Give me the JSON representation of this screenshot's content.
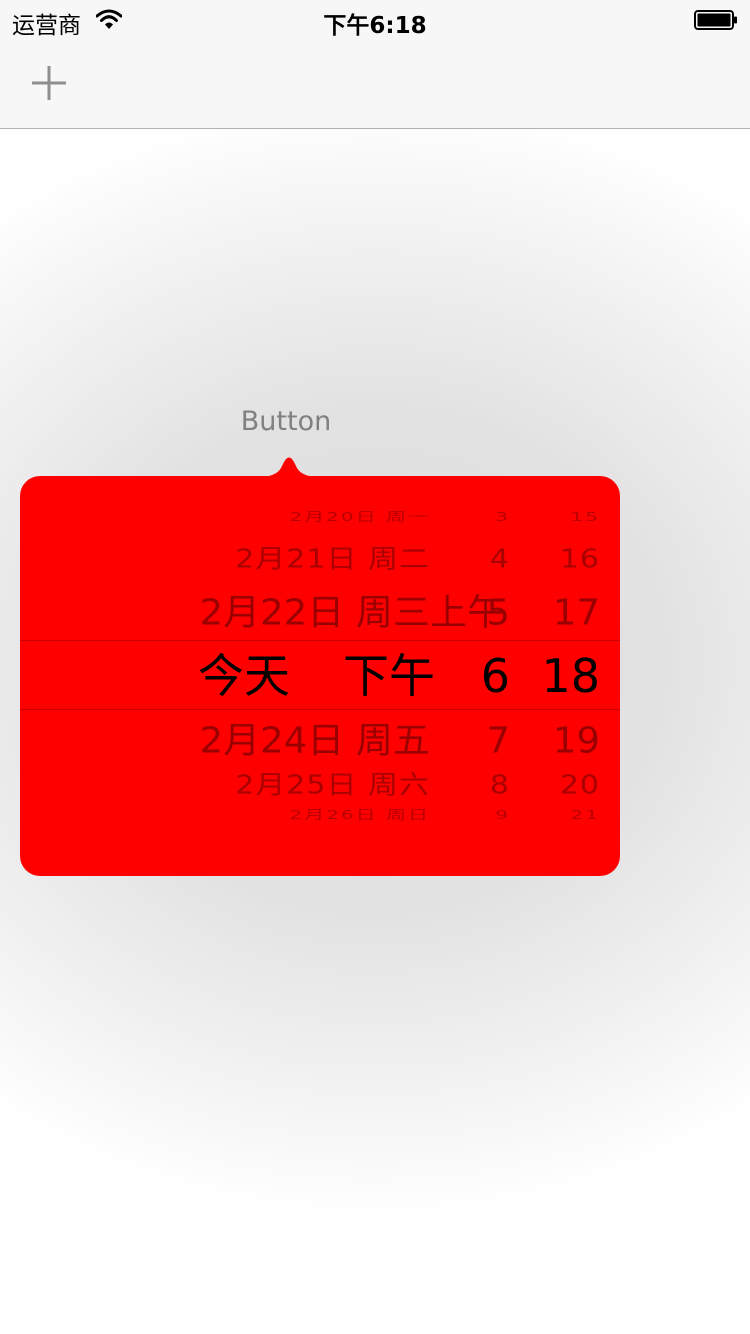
{
  "status_bar": {
    "carrier": "运营商",
    "time": "下午6:18"
  },
  "navbar": {
    "add_icon": "plus-icon"
  },
  "trigger": {
    "label": "Button"
  },
  "picker": {
    "background_color": "#ff0000",
    "rows": [
      {
        "date": "2月20日 周一",
        "ampm": "",
        "hour": "3",
        "minute": "15"
      },
      {
        "date": "2月21日 周二",
        "ampm": "",
        "hour": "4",
        "minute": "16"
      },
      {
        "date": "2月22日 周三",
        "ampm": "上午",
        "hour": "5",
        "minute": "17"
      },
      {
        "date": "今天",
        "ampm": "下午",
        "hour": "6",
        "minute": "18"
      },
      {
        "date": "2月24日 周五",
        "ampm": "",
        "hour": "7",
        "minute": "19"
      },
      {
        "date": "2月25日 周六",
        "ampm": "",
        "hour": "8",
        "minute": "20"
      },
      {
        "date": "2月26日 周日",
        "ampm": "",
        "hour": "9",
        "minute": "21"
      }
    ]
  }
}
